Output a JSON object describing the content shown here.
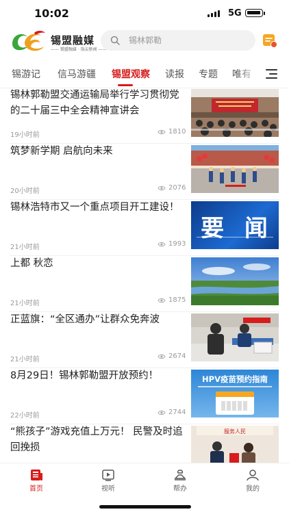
{
  "status_bar": {
    "time": "10:02",
    "network": "5G"
  },
  "header": {
    "app_name": "锡盟融媒",
    "app_tagline": "—— 锡盟融媒 · 指尖新闻 ——",
    "search_placeholder": "锡林郭勒"
  },
  "tabs": [
    {
      "label": "锡游记",
      "active": false
    },
    {
      "label": "信马游疆",
      "active": false
    },
    {
      "label": "锡盟观察",
      "active": true
    },
    {
      "label": "读报",
      "active": false
    },
    {
      "label": "专题",
      "active": false
    },
    {
      "label": "唯有",
      "active": false
    }
  ],
  "news": [
    {
      "title": "锡林郭勒盟交通运输局举行学习贯彻党的二十届三中全会精神宣讲会",
      "time": "19小时前",
      "views": "1810",
      "thumb": "meeting-photo"
    },
    {
      "title": "筑梦新学期 启航向未来",
      "time": "20小时前",
      "views": "2076",
      "thumb": "school-photo"
    },
    {
      "title": "锡林浩特市又一个重点项目开工建设！",
      "time": "21小时前",
      "views": "1993",
      "thumb": "important-news-banner",
      "thumb_text": "要  闻"
    },
    {
      "title": "上都 秋恋",
      "time": "21小时前",
      "views": "1875",
      "thumb": "grassland-photo"
    },
    {
      "title": "正蓝旗：“全区通办”让群众免奔波",
      "time": "21小时前",
      "views": "2674",
      "thumb": "service-hall-photo"
    },
    {
      "title": "8月29日！锡林郭勒盟开放预约！",
      "time": "22小时前",
      "views": "2744",
      "thumb": "hpv-banner",
      "thumb_text": "HPV疫苗预约指南"
    },
    {
      "title": "“熊孩子”游戏充值上万元！ 民警及时追回挽损",
      "time": "",
      "views": "",
      "thumb": "police-photo",
      "thumb_text": "服务人民"
    }
  ],
  "bottom_nav": [
    {
      "label": "首页",
      "icon": "home-news-icon",
      "active": true
    },
    {
      "label": "视听",
      "icon": "video-icon",
      "active": false
    },
    {
      "label": "帮办",
      "icon": "help-desk-icon",
      "active": false
    },
    {
      "label": "我的",
      "icon": "user-icon",
      "active": false
    }
  ],
  "colors": {
    "accent": "#d61c1c"
  }
}
